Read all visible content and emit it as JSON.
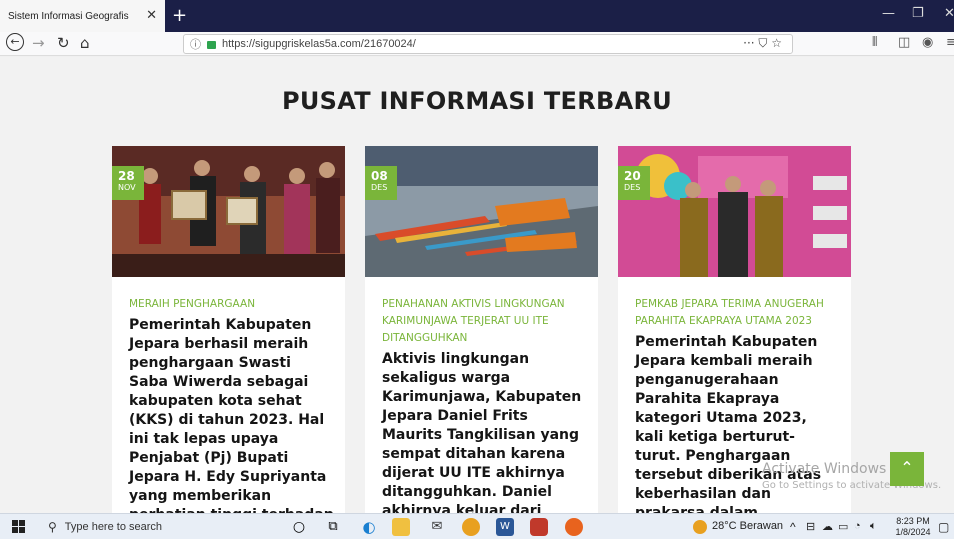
{
  "browser": {
    "tab_title": "Sistem Informasi Geografis",
    "tab_close": "✕",
    "new_tab": "+",
    "url": "https://sigupgriskelas5a.com/21670024/",
    "url_actions": "··· ⛉ ☆"
  },
  "page": {
    "heading": "PUSAT INFORMASI TERBARU",
    "cards": [
      {
        "day": "28",
        "month": "NOV",
        "category": "MERAIH PENGHARGAAN",
        "excerpt": "Pemerintah Kabupaten Jepara berhasil meraih penghargaan Swasti Saba Wiwerda sebagai kabupaten kota sehat (KKS) di tahun 2023. Hal ini tak lepas upaya Penjabat (Pj) Bupati Jepara H. Edy Supriyanta yang memberikan perhatian tinggi terhadap kesehatan"
      },
      {
        "day": "08",
        "month": "DES",
        "category": "PENAHANAN AKTIVIS LINGKUNGAN KARIMUNJAWA TERJERAT UU ITE DITANGGUHKAN",
        "excerpt": "Aktivis lingkungan sekaligus warga Karimunjawa, Kabupaten Jepara Daniel Frits Maurits Tangkilisan yang sempat ditahan karena dijerat UU ITE akhirnya ditangguhkan. Daniel akhirnya keluar dari ruang tahanan Polres"
      },
      {
        "day": "20",
        "month": "DES",
        "category": "PEMKAB JEPARA TERIMA ANUGERAH PARAHITA EKAPRAYA UTAMA 2023",
        "excerpt": "Pemerintah Kabupaten Jepara kembali meraih penganugerahaan Parahita Ekapraya kategori Utama 2023, kali ketiga berturut-turut. Penghargaan tersebut diberikan atas keberhasilan dan prakarsa dalam pencapaian"
      }
    ],
    "watermark_title": "Activate Windows",
    "watermark_sub": "Go to Settings to activate Windows.",
    "scroll_top": "⌃"
  },
  "taskbar": {
    "search_placeholder": "Type here to search",
    "weather": "28°C  Berawan",
    "time": "8:23 PM",
    "date": "1/8/2024"
  },
  "colors": {
    "accent_green": "#7ab53a",
    "tab_bar": "#1b1f47"
  }
}
